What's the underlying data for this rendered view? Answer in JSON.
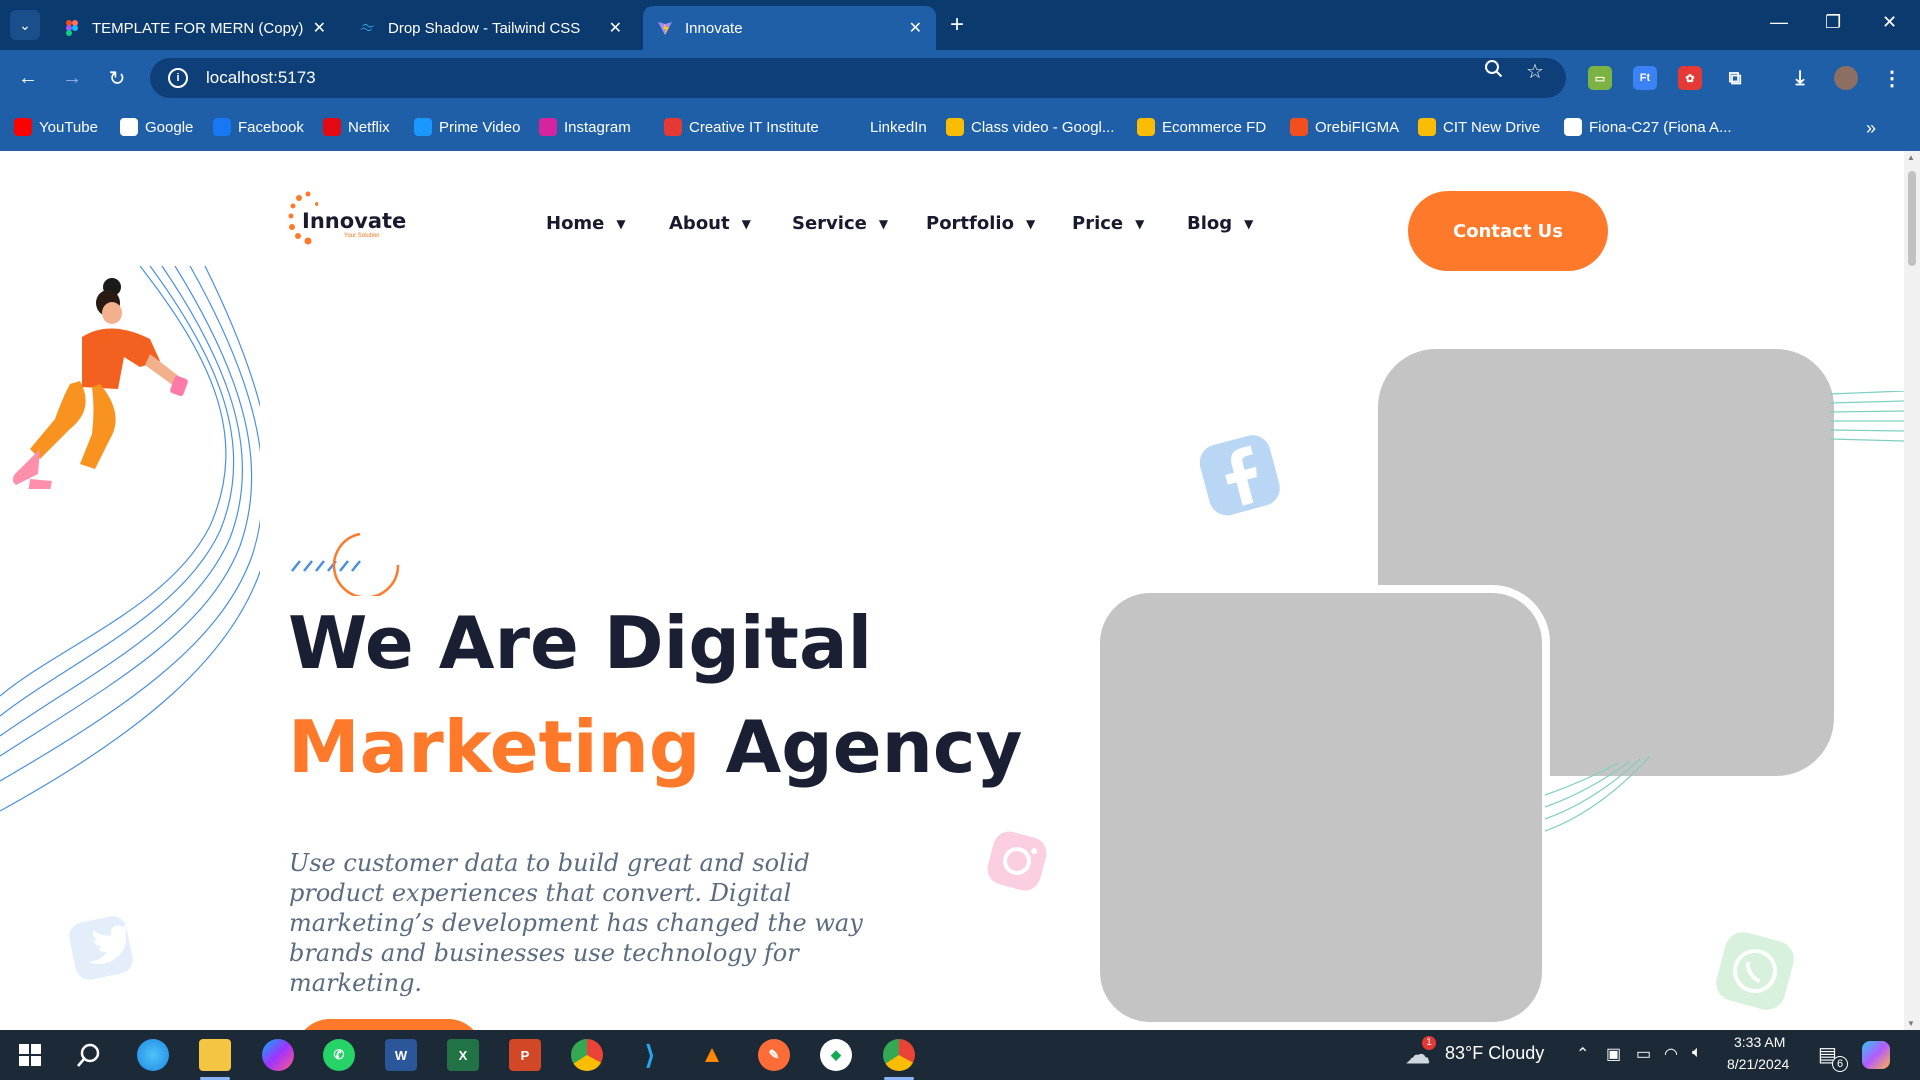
{
  "browser": {
    "tabs": [
      {
        "title": "TEMPLATE FOR MERN (Copy) –",
        "icon": "figma-icon",
        "active": false
      },
      {
        "title": "Drop Shadow - Tailwind CSS",
        "icon": "tailwind-icon",
        "active": false
      },
      {
        "title": "Innovate",
        "icon": "vite-icon",
        "active": true
      }
    ],
    "url": "localhost:5173",
    "bookmarks": [
      {
        "label": "YouTube",
        "icon": "youtube-icon",
        "color": "#ff0000"
      },
      {
        "label": "Google",
        "icon": "google-icon",
        "color": "#ffffff"
      },
      {
        "label": "Facebook",
        "icon": "facebook-icon",
        "color": "#1877f2"
      },
      {
        "label": "Netflix",
        "icon": "netflix-icon",
        "color": "#e50914"
      },
      {
        "label": "Prime Video",
        "icon": "prime-video-icon",
        "color": "#1a98ff"
      },
      {
        "label": "Instagram",
        "icon": "instagram-icon",
        "color": "#d6249f"
      },
      {
        "label": "Creative IT Institute",
        "icon": "creative-it-icon",
        "color": "#e53935"
      },
      {
        "label": "LinkedIn",
        "icon": "linkedin-icon",
        "color": "#1f5fa8"
      },
      {
        "label": "Class video - Googl...",
        "icon": "google-drive-icon",
        "color": "#fbbc04"
      },
      {
        "label": "Ecommerce FD",
        "icon": "google-drive-icon",
        "color": "#fbbc04"
      },
      {
        "label": "OrebiFIGMA",
        "icon": "figma-icon",
        "color": "#f24e1e"
      },
      {
        "label": "CIT New Drive",
        "icon": "google-drive-icon",
        "color": "#fbbc04"
      },
      {
        "label": "Fiona-C27 (Fiona A...",
        "icon": "github-icon",
        "color": "#ffffff"
      }
    ]
  },
  "site": {
    "logo": {
      "name": "Innovate",
      "tagline": "Your Solution"
    },
    "nav": [
      {
        "label": "Home"
      },
      {
        "label": "About"
      },
      {
        "label": "Service"
      },
      {
        "label": "Portfolio"
      },
      {
        "label": "Price"
      },
      {
        "label": "Blog"
      }
    ],
    "contact_label": "Contact Us",
    "hero": {
      "line1": "We Are Digital",
      "line2_highlight": "Marketing",
      "line2_rest": " Agency",
      "paragraph": "Use customer data to build great and solid product experiences that convert. Digital marketing’s development has changed the way brands and businesses use technology for marketing."
    },
    "colors": {
      "accent": "#fe7a2a",
      "heading": "#1a1f33",
      "muted": "#5b6b80"
    }
  },
  "taskbar": {
    "weather": "83°F  Cloudy",
    "weather_badge": "1",
    "time": "3:33 AM",
    "date": "8/21/2024",
    "notifications": "6"
  }
}
